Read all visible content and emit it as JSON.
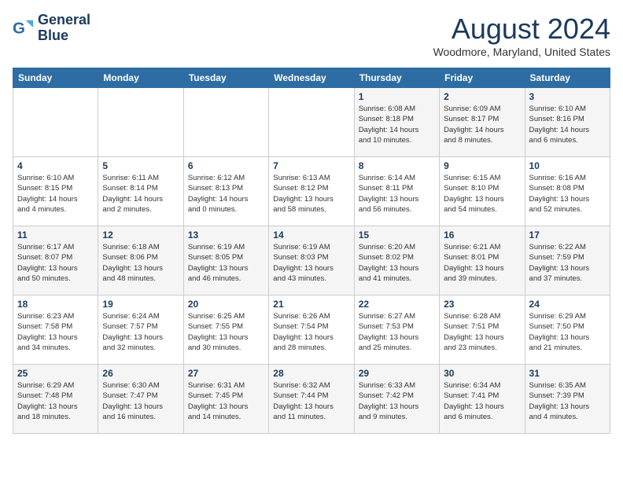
{
  "header": {
    "logo_line1": "General",
    "logo_line2": "Blue",
    "month_year": "August 2024",
    "location": "Woodmore, Maryland, United States"
  },
  "weekdays": [
    "Sunday",
    "Monday",
    "Tuesday",
    "Wednesday",
    "Thursday",
    "Friday",
    "Saturday"
  ],
  "weeks": [
    [
      {
        "day": "",
        "info": ""
      },
      {
        "day": "",
        "info": ""
      },
      {
        "day": "",
        "info": ""
      },
      {
        "day": "",
        "info": ""
      },
      {
        "day": "1",
        "info": "Sunrise: 6:08 AM\nSunset: 8:18 PM\nDaylight: 14 hours\nand 10 minutes."
      },
      {
        "day": "2",
        "info": "Sunrise: 6:09 AM\nSunset: 8:17 PM\nDaylight: 14 hours\nand 8 minutes."
      },
      {
        "day": "3",
        "info": "Sunrise: 6:10 AM\nSunset: 8:16 PM\nDaylight: 14 hours\nand 6 minutes."
      }
    ],
    [
      {
        "day": "4",
        "info": "Sunrise: 6:10 AM\nSunset: 8:15 PM\nDaylight: 14 hours\nand 4 minutes."
      },
      {
        "day": "5",
        "info": "Sunrise: 6:11 AM\nSunset: 8:14 PM\nDaylight: 14 hours\nand 2 minutes."
      },
      {
        "day": "6",
        "info": "Sunrise: 6:12 AM\nSunset: 8:13 PM\nDaylight: 14 hours\nand 0 minutes."
      },
      {
        "day": "7",
        "info": "Sunrise: 6:13 AM\nSunset: 8:12 PM\nDaylight: 13 hours\nand 58 minutes."
      },
      {
        "day": "8",
        "info": "Sunrise: 6:14 AM\nSunset: 8:11 PM\nDaylight: 13 hours\nand 56 minutes."
      },
      {
        "day": "9",
        "info": "Sunrise: 6:15 AM\nSunset: 8:10 PM\nDaylight: 13 hours\nand 54 minutes."
      },
      {
        "day": "10",
        "info": "Sunrise: 6:16 AM\nSunset: 8:08 PM\nDaylight: 13 hours\nand 52 minutes."
      }
    ],
    [
      {
        "day": "11",
        "info": "Sunrise: 6:17 AM\nSunset: 8:07 PM\nDaylight: 13 hours\nand 50 minutes."
      },
      {
        "day": "12",
        "info": "Sunrise: 6:18 AM\nSunset: 8:06 PM\nDaylight: 13 hours\nand 48 minutes."
      },
      {
        "day": "13",
        "info": "Sunrise: 6:19 AM\nSunset: 8:05 PM\nDaylight: 13 hours\nand 46 minutes."
      },
      {
        "day": "14",
        "info": "Sunrise: 6:19 AM\nSunset: 8:03 PM\nDaylight: 13 hours\nand 43 minutes."
      },
      {
        "day": "15",
        "info": "Sunrise: 6:20 AM\nSunset: 8:02 PM\nDaylight: 13 hours\nand 41 minutes."
      },
      {
        "day": "16",
        "info": "Sunrise: 6:21 AM\nSunset: 8:01 PM\nDaylight: 13 hours\nand 39 minutes."
      },
      {
        "day": "17",
        "info": "Sunrise: 6:22 AM\nSunset: 7:59 PM\nDaylight: 13 hours\nand 37 minutes."
      }
    ],
    [
      {
        "day": "18",
        "info": "Sunrise: 6:23 AM\nSunset: 7:58 PM\nDaylight: 13 hours\nand 34 minutes."
      },
      {
        "day": "19",
        "info": "Sunrise: 6:24 AM\nSunset: 7:57 PM\nDaylight: 13 hours\nand 32 minutes."
      },
      {
        "day": "20",
        "info": "Sunrise: 6:25 AM\nSunset: 7:55 PM\nDaylight: 13 hours\nand 30 minutes."
      },
      {
        "day": "21",
        "info": "Sunrise: 6:26 AM\nSunset: 7:54 PM\nDaylight: 13 hours\nand 28 minutes."
      },
      {
        "day": "22",
        "info": "Sunrise: 6:27 AM\nSunset: 7:53 PM\nDaylight: 13 hours\nand 25 minutes."
      },
      {
        "day": "23",
        "info": "Sunrise: 6:28 AM\nSunset: 7:51 PM\nDaylight: 13 hours\nand 23 minutes."
      },
      {
        "day": "24",
        "info": "Sunrise: 6:29 AM\nSunset: 7:50 PM\nDaylight: 13 hours\nand 21 minutes."
      }
    ],
    [
      {
        "day": "25",
        "info": "Sunrise: 6:29 AM\nSunset: 7:48 PM\nDaylight: 13 hours\nand 18 minutes."
      },
      {
        "day": "26",
        "info": "Sunrise: 6:30 AM\nSunset: 7:47 PM\nDaylight: 13 hours\nand 16 minutes."
      },
      {
        "day": "27",
        "info": "Sunrise: 6:31 AM\nSunset: 7:45 PM\nDaylight: 13 hours\nand 14 minutes."
      },
      {
        "day": "28",
        "info": "Sunrise: 6:32 AM\nSunset: 7:44 PM\nDaylight: 13 hours\nand 11 minutes."
      },
      {
        "day": "29",
        "info": "Sunrise: 6:33 AM\nSunset: 7:42 PM\nDaylight: 13 hours\nand 9 minutes."
      },
      {
        "day": "30",
        "info": "Sunrise: 6:34 AM\nSunset: 7:41 PM\nDaylight: 13 hours\nand 6 minutes."
      },
      {
        "day": "31",
        "info": "Sunrise: 6:35 AM\nSunset: 7:39 PM\nDaylight: 13 hours\nand 4 minutes."
      }
    ]
  ]
}
